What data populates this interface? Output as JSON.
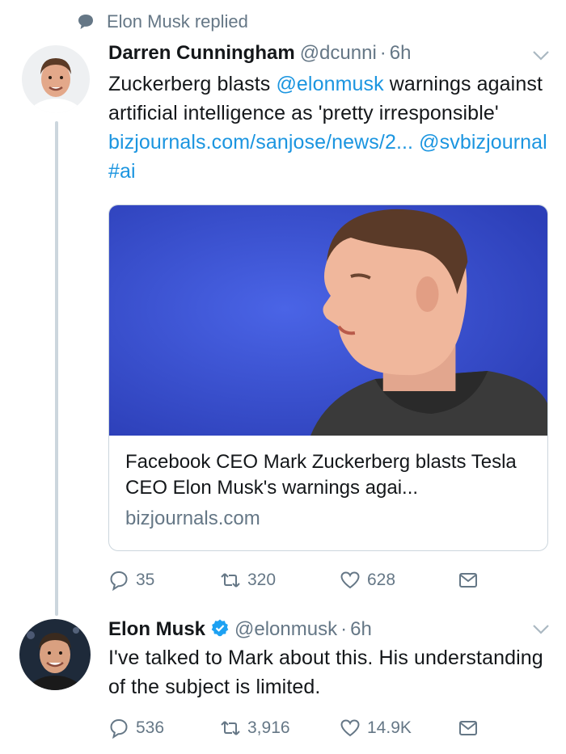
{
  "context": {
    "icon": "speech-bubble-icon",
    "text": "Elon Musk replied"
  },
  "tweets": [
    {
      "name": "Darren Cunningham",
      "handle": "@dcunni",
      "dot": "·",
      "time": "6h",
      "text_parts": [
        "Zuckerberg blasts ",
        "@elonmusk",
        " warnings against artificial intelligence as 'pretty irresponsible' ",
        "bizjournals.com/sanjose/news/2...",
        " ",
        "@svbizjournal",
        " ",
        "#ai"
      ],
      "card": {
        "title": "Facebook CEO Mark Zuckerberg blasts Tesla CEO Elon Musk's warnings agai...",
        "domain": "bizjournals.com"
      },
      "actions": {
        "replies": "35",
        "retweets": "320",
        "likes": "628"
      }
    },
    {
      "name": "Elon Musk",
      "handle": "@elonmusk",
      "dot": "·",
      "time": "6h",
      "verified": true,
      "text": "I've talked to Mark about this. His understanding of the subject is limited.",
      "actions": {
        "replies": "536",
        "retweets": "3,916",
        "likes": "14.9K"
      }
    }
  ],
  "colors": {
    "link": "#1b95e0",
    "secondary": "#657786",
    "verified": "#1da1f2",
    "thread_line": "#ccd6dd",
    "card_background": "#3f56d6"
  }
}
